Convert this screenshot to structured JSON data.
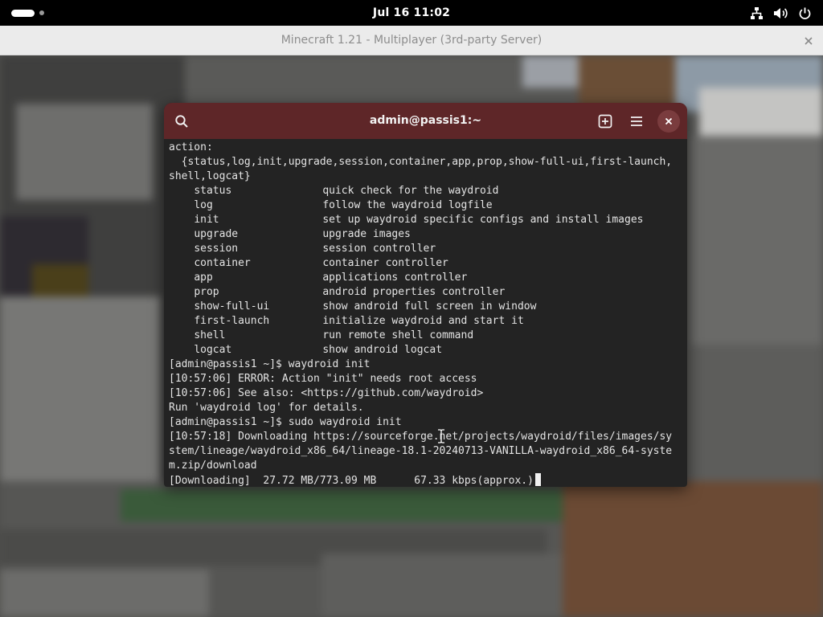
{
  "topbar": {
    "clock": "Jul 16  11:02",
    "icons": [
      "activities-indicator",
      "network-icon",
      "volume-icon",
      "power-icon"
    ]
  },
  "minecraft_window": {
    "title": "Minecraft 1.21 - Multiplayer (3rd-party Server)",
    "close_icon": "close-icon"
  },
  "terminal": {
    "title": "admin@passis1:~",
    "header_icons": [
      "search-icon",
      "new-tab-icon",
      "hamburger-menu-icon",
      "close-icon"
    ],
    "colors": {
      "header": "#5e2628",
      "background": "#232323",
      "text": "#e4e4e4"
    },
    "lines_before": [
      "action:",
      "  {status,log,init,upgrade,session,container,app,prop,show-full-ui,first-launch,",
      "shell,logcat}"
    ],
    "subcommands": [
      {
        "name": "status",
        "description": "quick check for the waydroid"
      },
      {
        "name": "log",
        "description": "follow the waydroid logfile"
      },
      {
        "name": "init",
        "description": "set up waydroid specific configs and install images"
      },
      {
        "name": "upgrade",
        "description": "upgrade images"
      },
      {
        "name": "session",
        "description": "session controller"
      },
      {
        "name": "container",
        "description": "container controller"
      },
      {
        "name": "app",
        "description": "applications controller"
      },
      {
        "name": "prop",
        "description": "android properties controller"
      },
      {
        "name": "show-full-ui",
        "description": "show android full screen in window"
      },
      {
        "name": "first-launch",
        "description": "initialize waydroid and start it"
      },
      {
        "name": "shell",
        "description": "run remote shell command"
      },
      {
        "name": "logcat",
        "description": "show android logcat"
      }
    ],
    "lines_after": [
      "[admin@passis1 ~]$ waydroid init",
      "[10:57:06] ERROR: Action \"init\" needs root access",
      "[10:57:06] See also: <https://github.com/waydroid>",
      "Run 'waydroid log' for details.",
      "[admin@passis1 ~]$ sudo waydroid init",
      "[10:57:18] Downloading https://sourceforge.net/projects/waydroid/files/images/sy",
      "stem/lineage/waydroid_x86_64/lineage-18.1-20240713-VANILLA-waydroid_x86_64-syste",
      "m.zip/download"
    ],
    "progress_line": "[Downloading]  27.72 MB/773.09 MB      67.33 kbps(approx.)"
  }
}
